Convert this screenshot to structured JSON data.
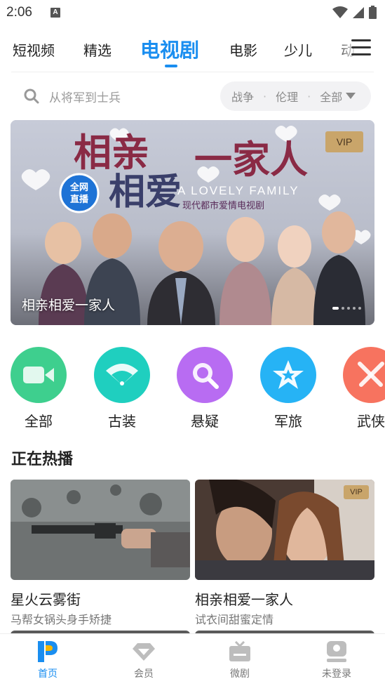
{
  "status_bar": {
    "time": "2:06",
    "notification_glyph": "A"
  },
  "top_nav": {
    "tabs": [
      {
        "label": "短视频"
      },
      {
        "label": "精选"
      },
      {
        "label": "电视剧"
      },
      {
        "label": "电影"
      },
      {
        "label": "少儿"
      },
      {
        "label": "动"
      }
    ],
    "active_tab": "电视剧"
  },
  "search": {
    "placeholder": "从将军到士兵"
  },
  "filter": {
    "items": [
      "战争",
      "伦理",
      "全部"
    ]
  },
  "banner": {
    "title_art": "相亲相爱一家人",
    "subtitle_en": "A LOVELY FAMILY",
    "subtitle_cn": "现代都市爱情电视剧",
    "badge_art": "全网直播",
    "vip_badge": "VIP",
    "caption": "相亲相爱一家人",
    "page_count": 5,
    "current_page": 1
  },
  "categories": [
    {
      "label": "全部",
      "icon": "video-camera-icon",
      "color": "#3ecf8e"
    },
    {
      "label": "古装",
      "icon": "fan-icon",
      "color": "#1fcfbf"
    },
    {
      "label": "悬疑",
      "icon": "magnifier-icon",
      "color": "#b86cf2"
    },
    {
      "label": "军旅",
      "icon": "star-icon",
      "color": "#26b3f5"
    },
    {
      "label": "武侠",
      "icon": "crossed-swords-icon",
      "color": "#f7735f"
    }
  ],
  "hot": {
    "title": "正在热播",
    "items": [
      {
        "title": "星火云雾街",
        "subtitle": "马帮女锅头身手矫捷",
        "vip": false
      },
      {
        "title": "相亲相爱一家人",
        "subtitle": "试衣间甜蜜定情",
        "vip": true,
        "vip_label": "VIP"
      }
    ]
  },
  "bottom_nav": {
    "items": [
      {
        "label": "首页",
        "icon": "home-logo-icon",
        "active": true
      },
      {
        "label": "会员",
        "icon": "diamond-icon",
        "active": false
      },
      {
        "label": "微剧",
        "icon": "tv-icon",
        "active": false
      },
      {
        "label": "未登录",
        "icon": "user-icon",
        "active": false
      }
    ]
  },
  "colors": {
    "accent": "#1a8ef0",
    "vip_gold": "#c9a56a",
    "text_primary": "#222222",
    "text_secondary": "#777777"
  }
}
